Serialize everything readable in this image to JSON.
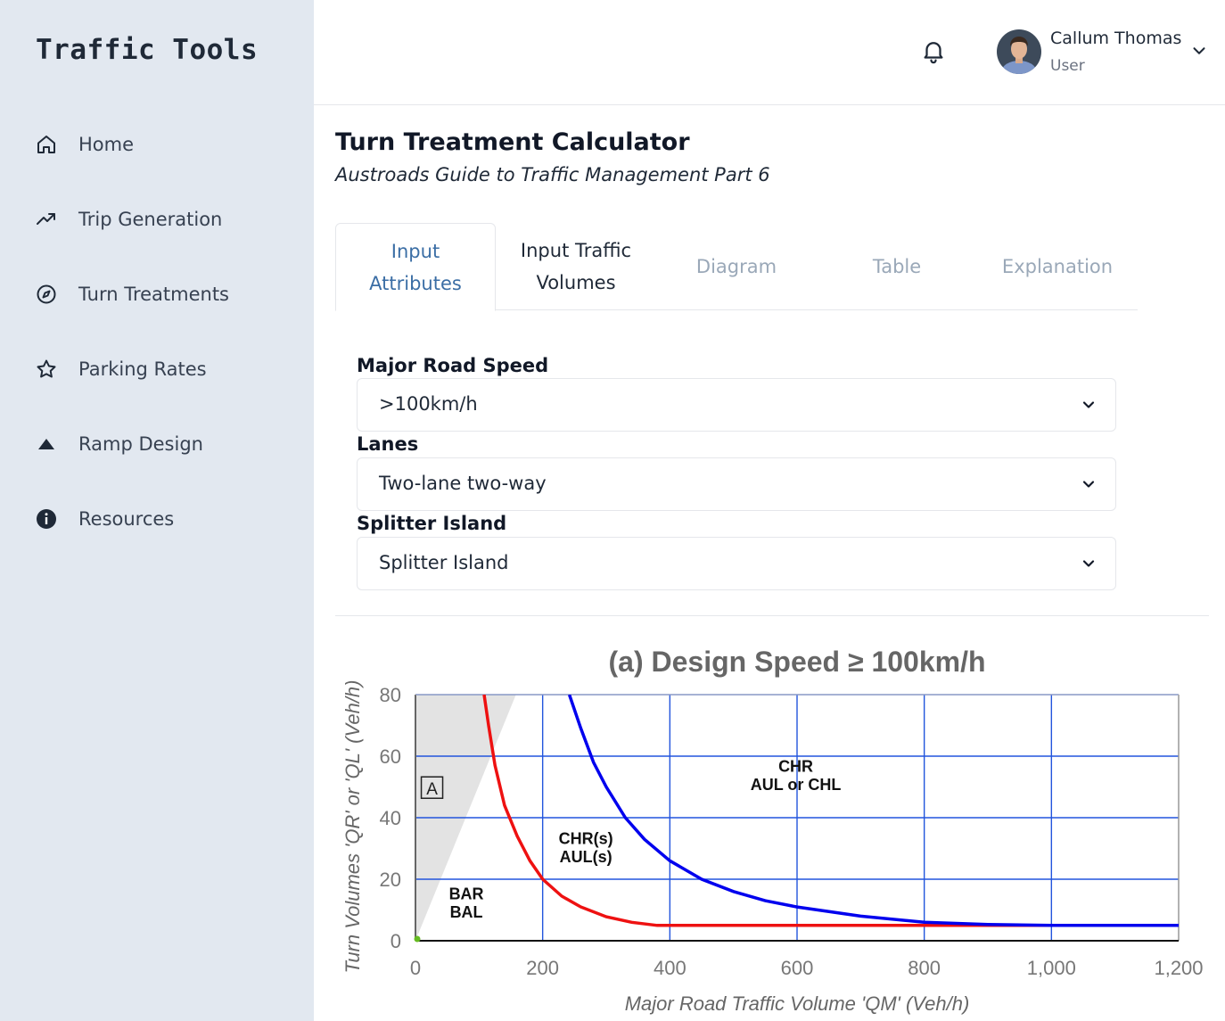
{
  "sidebar": {
    "brand": "Traffic Tools",
    "items": [
      {
        "label": "Home",
        "icon": "home-icon"
      },
      {
        "label": "Trip Generation",
        "icon": "trending-up-icon"
      },
      {
        "label": "Turn Treatments",
        "icon": "compass-icon"
      },
      {
        "label": "Parking Rates",
        "icon": "star-icon"
      },
      {
        "label": "Ramp Design",
        "icon": "triangle-icon"
      },
      {
        "label": "Resources",
        "icon": "info-icon"
      }
    ]
  },
  "header": {
    "user_name": "Callum Thomas",
    "user_role": "User"
  },
  "page": {
    "title": "Turn Treatment Calculator",
    "subtitle": "Austroads Guide to Traffic Management Part 6"
  },
  "tabs": [
    {
      "line1": "Input",
      "line2": "Attributes",
      "state": "active"
    },
    {
      "line1": "Input Traffic",
      "line2": "Volumes",
      "state": "normal"
    },
    {
      "line1": "Diagram",
      "line2": "",
      "state": "muted"
    },
    {
      "line1": "Table",
      "line2": "",
      "state": "muted"
    },
    {
      "line1": "Explanation",
      "line2": "",
      "state": "muted"
    }
  ],
  "form": {
    "speed_label": "Major Road Speed",
    "speed_value": ">100km/h",
    "lanes_label": "Lanes",
    "lanes_value": "Two-lane two-way",
    "splitter_label": "Splitter Island",
    "splitter_value": "Splitter Island"
  },
  "colors": {
    "accent": "#3b6ea5",
    "sidebar_bg": "#e2e8f0",
    "red_curve": "#ee1111",
    "blue_curve": "#0000ee",
    "grid": "#2255dd",
    "shade": "#e3e3e3"
  },
  "chart_data": {
    "type": "line",
    "title": "(a) Design Speed ≥ 100km/h",
    "xlabel": "Major Road Traffic Volume 'QM' (Veh/h)",
    "ylabel": "Turn Volumes 'QR' or 'QL' (Veh/h)",
    "xlim": [
      0,
      1200
    ],
    "ylim": [
      0,
      80
    ],
    "x_ticks": [
      0,
      200,
      400,
      600,
      800,
      1000,
      1200
    ],
    "x_tick_labels": [
      "0",
      "200",
      "400",
      "600",
      "800",
      "1,000",
      "1,200"
    ],
    "y_ticks": [
      0,
      20,
      40,
      60,
      80
    ],
    "y_tick_labels": [
      "0",
      "20",
      "40",
      "60",
      "80"
    ],
    "grid": true,
    "shaded_region": {
      "label": "A",
      "polygon": [
        [
          0,
          0
        ],
        [
          0,
          80
        ],
        [
          158,
          80
        ]
      ]
    },
    "series": [
      {
        "color": "#ee1111",
        "x": [
          108,
          115,
          125,
          140,
          160,
          180,
          200,
          230,
          260,
          300,
          340,
          380,
          400,
          500,
          700,
          900,
          1000
        ],
        "y": [
          80,
          70,
          57,
          44,
          34,
          26,
          20,
          14.5,
          11,
          7.8,
          6,
          5,
          5,
          5,
          5,
          5,
          5
        ]
      },
      {
        "color": "#0000ee",
        "x": [
          242,
          260,
          280,
          300,
          330,
          360,
          400,
          450,
          500,
          550,
          600,
          700,
          800,
          900,
          1000,
          1100,
          1200
        ],
        "y": [
          80,
          69,
          58,
          50,
          40,
          33,
          26,
          20,
          16,
          13,
          11,
          8,
          6,
          5.3,
          5,
          5,
          5
        ]
      }
    ],
    "annotations": [
      {
        "text": "CHR",
        "x": 598,
        "y": 55
      },
      {
        "text": "AUL or CHL",
        "x": 598,
        "y": 49
      },
      {
        "text": "CHR(s)",
        "x": 268,
        "y": 31.5
      },
      {
        "text": "AUL(s)",
        "x": 268,
        "y": 25.5
      },
      {
        "text": "BAR",
        "x": 80,
        "y": 13.5
      },
      {
        "text": "BAL",
        "x": 80,
        "y": 7.5
      }
    ]
  }
}
